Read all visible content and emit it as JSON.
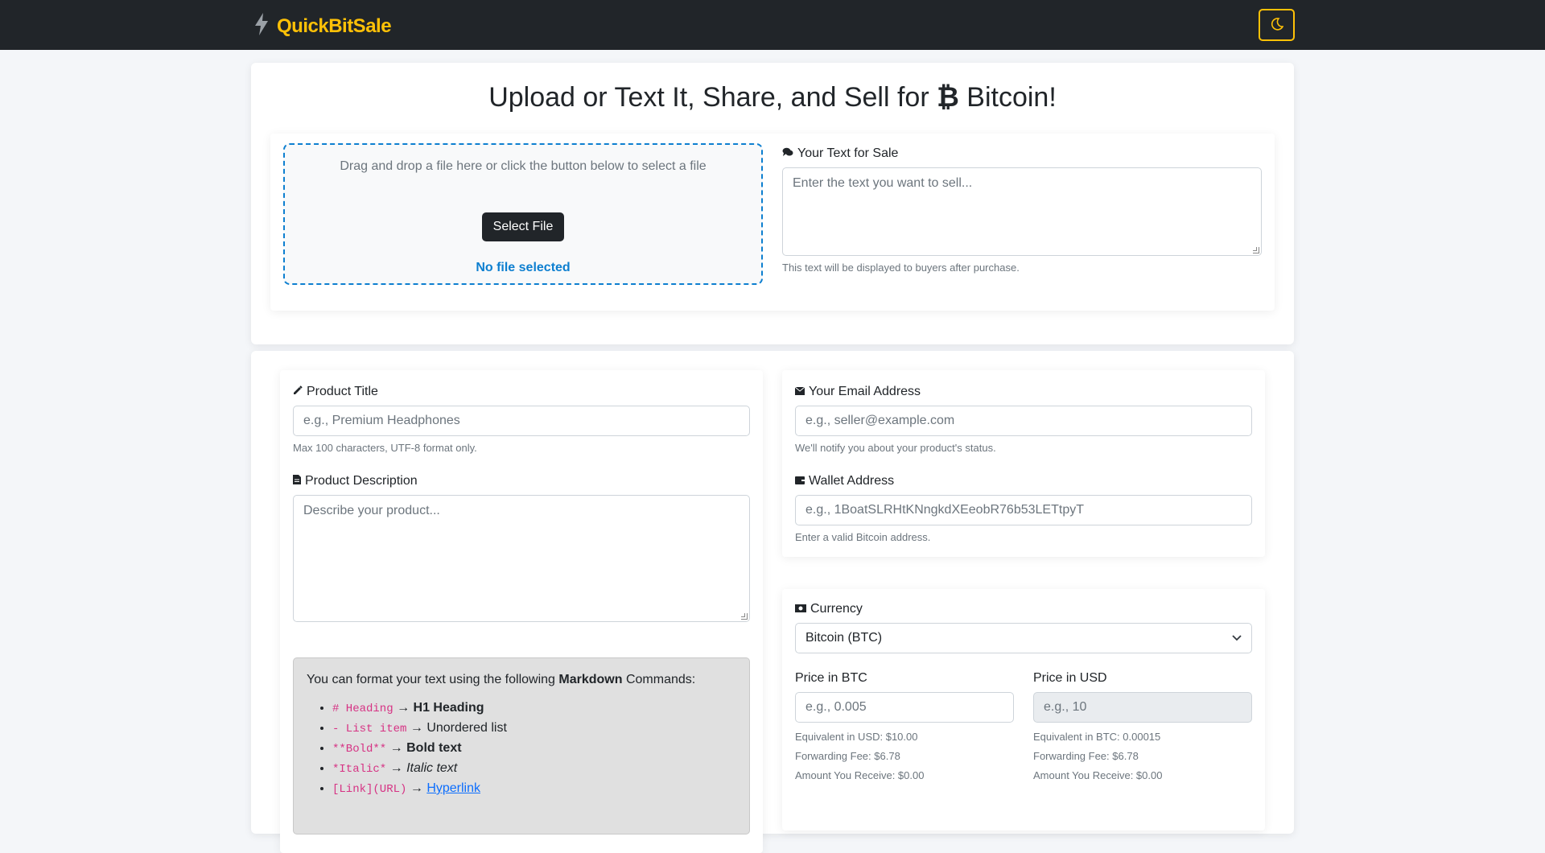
{
  "nav": {
    "brand": "QuickBitSale",
    "theme_toggle_icon": "moon-icon",
    "accent_color": "#ffc107"
  },
  "hero": {
    "title": "Upload or Text It, Share, and Sell for",
    "title_suffix": "Bitcoin!",
    "drop_hint": "Drag and drop a file here or click the button below to select a file",
    "select_button": "Select File",
    "file_status": "No file selected",
    "text_label": "Your Text for Sale",
    "text_placeholder": "Enter the text you want to sell...",
    "text_help": "This text will be displayed to buyers after purchase."
  },
  "product": {
    "title_label": "Product Title",
    "title_placeholder": "e.g., Premium Headphones",
    "title_help": "Max 100 characters, UTF-8 format only.",
    "desc_label": "Product Description",
    "desc_placeholder": "Describe your product..."
  },
  "markdown": {
    "intro_pre": "You can format your text using the following",
    "intro_bold": "Markdown",
    "intro_post": "Commands:",
    "items": [
      {
        "code": "# Heading",
        "arrow": " → ",
        "result": "H1 Heading"
      },
      {
        "code": "- List item",
        "arrow": " → ",
        "result": "Unordered list"
      },
      {
        "code": "**Bold**",
        "arrow": " → ",
        "result": "Bold text"
      },
      {
        "code": "*Italic*",
        "arrow": " → ",
        "result": "Italic text"
      },
      {
        "code": "[Link](URL)",
        "arrow": " → ",
        "result": "Hyperlink"
      }
    ]
  },
  "seller": {
    "email_label": "Your Email Address",
    "email_placeholder": "e.g., seller@example.com",
    "email_help": "We'll notify you about your product's status.",
    "wallet_label": "Wallet Address",
    "wallet_placeholder": "e.g., 1BoatSLRHtKNngkdXEeobR76b53LETtpyT",
    "wallet_help": "Enter a valid Bitcoin address."
  },
  "pricing": {
    "currency_label": "Currency",
    "currency_value": "Bitcoin (BTC)",
    "btc_label": "Price in BTC",
    "btc_placeholder": "e.g., 0.005",
    "btc_equiv": "Equivalent in USD: $10.00",
    "btc_fee": "Forwarding Fee: $6.78",
    "btc_receive": "Amount You Receive: $0.00",
    "usd_label": "Price in USD",
    "usd_placeholder": "e.g., 10",
    "usd_equiv": "Equivalent in BTC: 0.00015",
    "usd_fee": "Forwarding Fee: $6.78",
    "usd_receive": "Amount You Receive: $0.00"
  }
}
